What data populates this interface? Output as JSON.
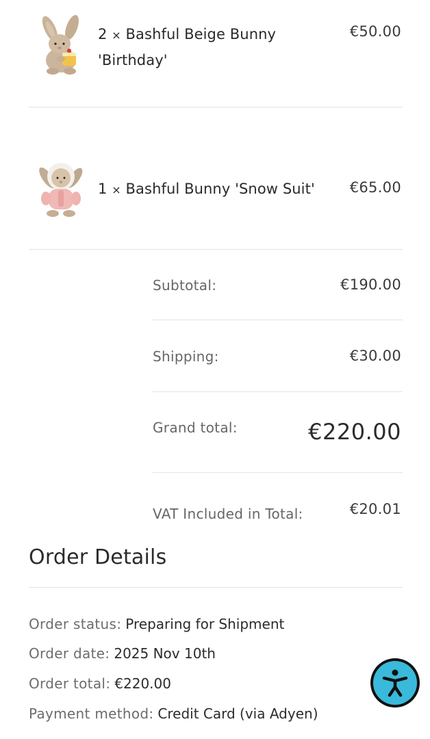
{
  "order_items": [
    {
      "qty": "2",
      "times": "×",
      "name_line1": "Bashful Beige Bunny",
      "name_line2": "'Birthday'",
      "price": "€50.00",
      "thumbnail": "beige-bunny-birthday-image"
    },
    {
      "qty": "1",
      "times": "×",
      "name_line1": "Bashful Bunny 'Snow Suit'",
      "price": "€65.00",
      "thumbnail": "bunny-snow-suit-image"
    }
  ],
  "summary": {
    "subtotal_label": "Subtotal:",
    "subtotal_value": "€190.00",
    "shipping_label": "Shipping:",
    "shipping_value": "€30.00",
    "grand_total_label": "Grand total:",
    "grand_total_value": "€220.00",
    "vat_label": "VAT Included in Total:",
    "vat_value": "€20.01"
  },
  "order_details": {
    "title": "Order Details",
    "rows": [
      {
        "label": "Order status:",
        "value": "Preparing for Shipment"
      },
      {
        "label": "Order date:",
        "value": "2025 Nov 10th"
      },
      {
        "label": "Order total:",
        "value": "€220.00"
      },
      {
        "label": "Payment method:",
        "value": "Credit Card (via Adyen)"
      }
    ]
  },
  "accessibility_button": {
    "icon": "accessibility-person-icon",
    "color": "#3ab9db"
  },
  "colors": {
    "text_primary": "#2b2b2b",
    "text_muted": "#666666",
    "divider": "#e3e3e3"
  }
}
